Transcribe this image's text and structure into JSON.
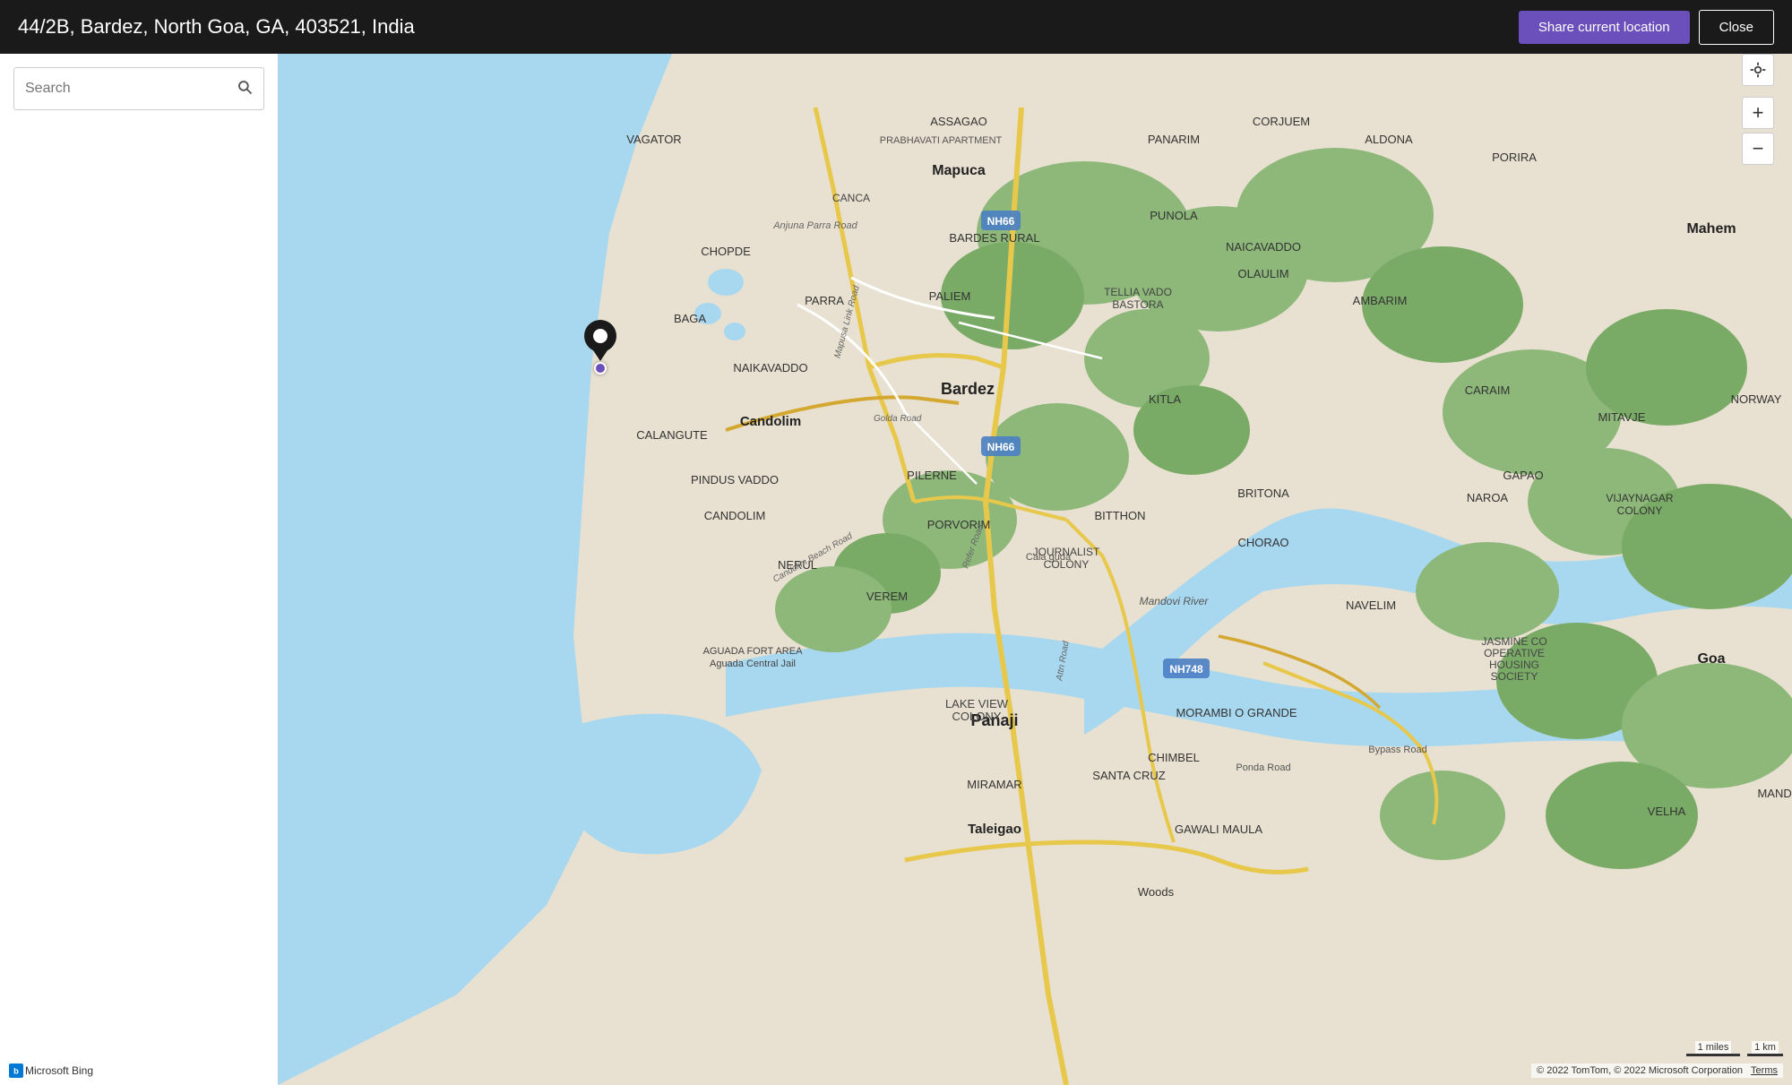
{
  "header": {
    "title": "44/2B, Bardez, North Goa, GA, 403521, India",
    "share_btn_label": "Share current location",
    "close_btn_label": "Close"
  },
  "search": {
    "placeholder": "Search"
  },
  "map": {
    "attribution": "© 2022 TomTom, © 2022 Microsoft Corporation",
    "terms_label": "Terms",
    "scale_1mi": "1 miles",
    "scale_1km": "1 km"
  },
  "controls": {
    "locate_icon": "⊕",
    "zoom_in_icon": "+",
    "zoom_out_icon": "−"
  },
  "bing_logo": "Microsoft Bing"
}
